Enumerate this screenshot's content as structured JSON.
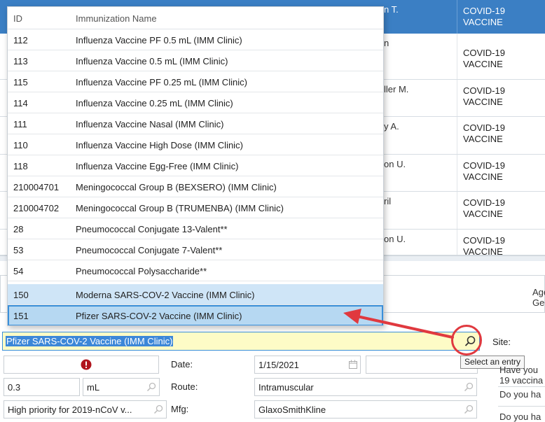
{
  "background_grid": {
    "rows": [
      {
        "name": "n T.",
        "vaccine": "COVID-19 VACCINE"
      },
      {
        "name": "n",
        "vaccine": "COVID-19 VACCINE"
      },
      {
        "name": "ller M.",
        "vaccine": "COVID-19 VACCINE"
      },
      {
        "name": "y A.",
        "vaccine": "COVID-19 VACCINE"
      },
      {
        "name": "on U.",
        "vaccine": "COVID-19 VACCINE"
      },
      {
        "name": "ril",
        "vaccine": "COVID-19 VACCINE"
      },
      {
        "name": "on U.",
        "vaccine": "COVID-19 VACCINE"
      }
    ],
    "age_label_line1": "Age",
    "age_label_line2": "Ge"
  },
  "dropdown": {
    "headers": {
      "id": "ID",
      "name": "Immunization Name"
    },
    "rows": [
      {
        "id": "112",
        "name": "Influenza Vaccine PF 0.5 mL (IMM Clinic)"
      },
      {
        "id": "113",
        "name": "Influenza Vaccine 0.5 mL (IMM Clinic)"
      },
      {
        "id": "115",
        "name": "Influenza Vaccine PF 0.25 mL (IMM Clinic)"
      },
      {
        "id": "114",
        "name": "Influenza Vaccine 0.25 mL (IMM Clinic)"
      },
      {
        "id": "111",
        "name": "Influenza Vaccine Nasal (IMM Clinic)"
      },
      {
        "id": "110",
        "name": "Influenza Vaccine High Dose (IMM Clinic)"
      },
      {
        "id": "118",
        "name": "Influenza Vaccine Egg-Free (IMM Clinic)"
      },
      {
        "id": "210004701",
        "name": "Meningococcal Group B (BEXSERO) (IMM Clinic)"
      },
      {
        "id": "210004702",
        "name": "Meningococcal Group B (TRUMENBA) (IMM Clinic)"
      },
      {
        "id": "28",
        "name": "Pneumococcal Conjugate 13-Valent**"
      },
      {
        "id": "53",
        "name": "Pneumococcal Conjugate 7-Valent**"
      },
      {
        "id": "54",
        "name": "Pneumococcal Polysaccharide**"
      },
      {
        "id": "150",
        "name": "Moderna SARS-COV-2 Vaccine (IMM Clinic)"
      },
      {
        "id": "151",
        "name": "Pfizer SARS-COV-2 Vaccine (IMM Clinic)"
      }
    ],
    "highlighted_index": 12,
    "selected_index": 13
  },
  "form": {
    "immunization_value": "Pfizer SARS-COV-2 Vaccine (IMM Clinic)",
    "site_label": "Site:",
    "tooltip": "Select an entry",
    "date_label": "Date:",
    "date_value": "1/15/2021",
    "dose_value": "0.3",
    "unit_value": "mL",
    "route_label": "Route:",
    "route_value": "Intramuscular",
    "priority_value": "High priority for 2019-nCoV v...",
    "mfg_label": "Mfg:",
    "mfg_value": "GlaxoSmithKline",
    "questions": [
      "Have you",
      "19 vaccina",
      "Do you ha",
      "Do you ha"
    ]
  },
  "colors": {
    "header_blue": "#3b7fc4",
    "selected_row": "#b6d8f2",
    "highlight_row": "#cfe5f7",
    "combo_fill": "#fdfbc6",
    "annotation_red": "#e0393f",
    "error_red": "#b0141d"
  },
  "icons": [
    "search-icon",
    "calendar-icon",
    "error-icon"
  ]
}
